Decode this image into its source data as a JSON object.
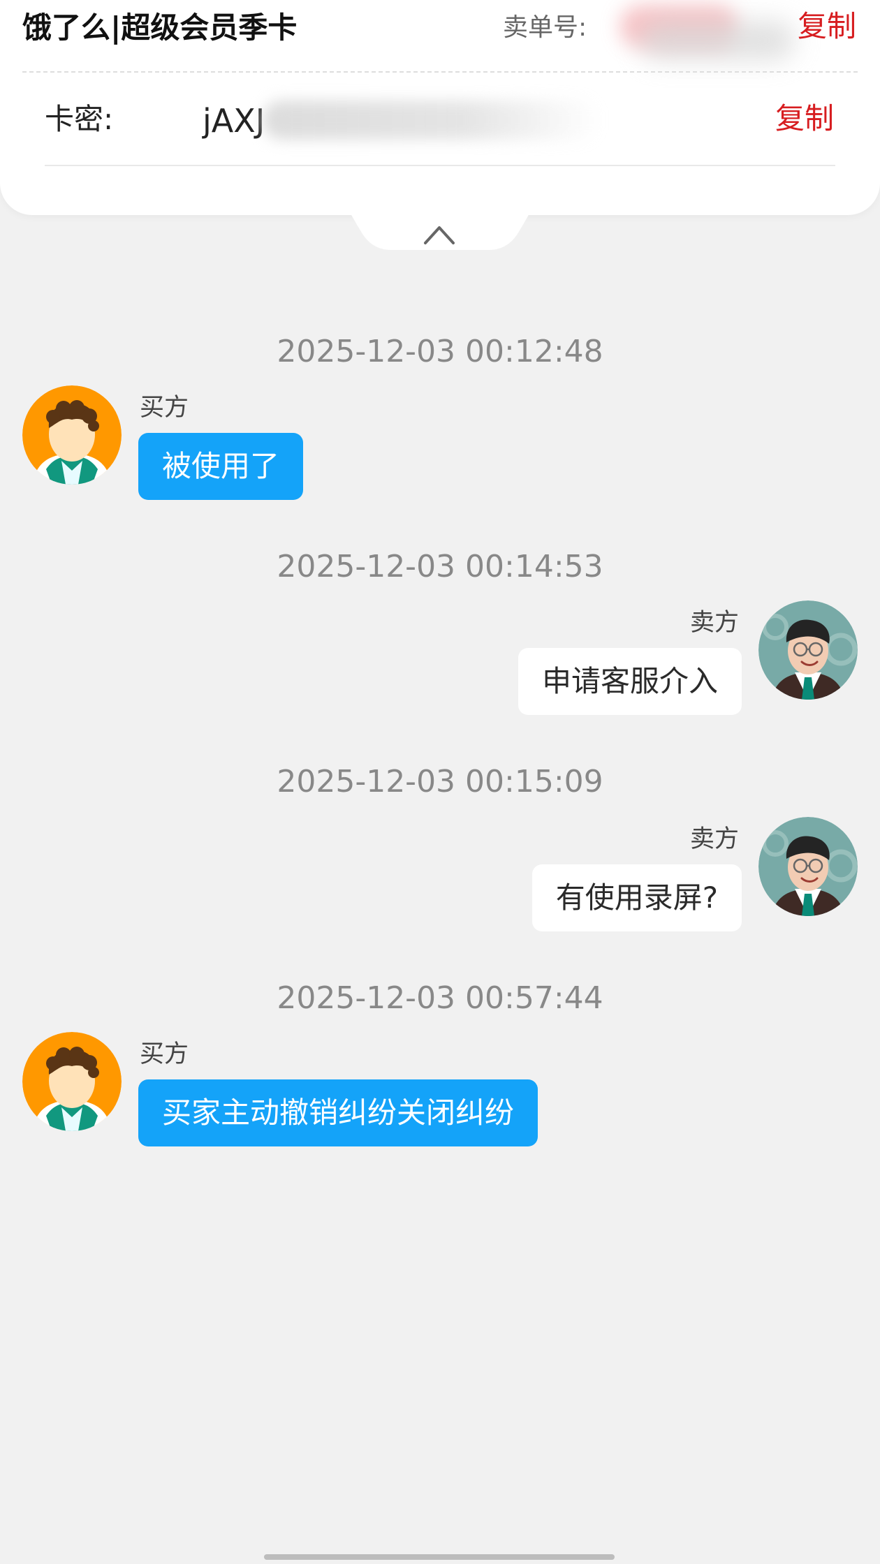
{
  "header": {
    "product_title": "饿了么|超级会员季卡",
    "order_label": "卖单号:",
    "order_copy_label": "复制"
  },
  "card": {
    "label": "卡密:",
    "code_visible": "jAXJ",
    "copy_label": "复制"
  },
  "icons": {
    "collapse": "chevron-up-icon"
  },
  "messages": [
    {
      "timestamp": "2025-12-03 00:12:48",
      "sender": "买方",
      "role": "buyer",
      "text": "被使用了"
    },
    {
      "timestamp": "2025-12-03 00:14:53",
      "sender": "卖方",
      "role": "seller",
      "text": "申请客服介入"
    },
    {
      "timestamp": "2025-12-03 00:15:09",
      "sender": "卖方",
      "role": "seller",
      "text": "有使用录屏?"
    },
    {
      "timestamp": "2025-12-03 00:57:44",
      "sender": "买方",
      "role": "buyer",
      "text": "买家主动撤销纠纷关闭纠纷"
    }
  ],
  "colors": {
    "background": "#f1f1f1",
    "card": "#ffffff",
    "copy_red": "#d71d20",
    "buyer_bubble": "#14a3f9",
    "seller_bubble": "#ffffff",
    "timestamp": "#888888"
  }
}
